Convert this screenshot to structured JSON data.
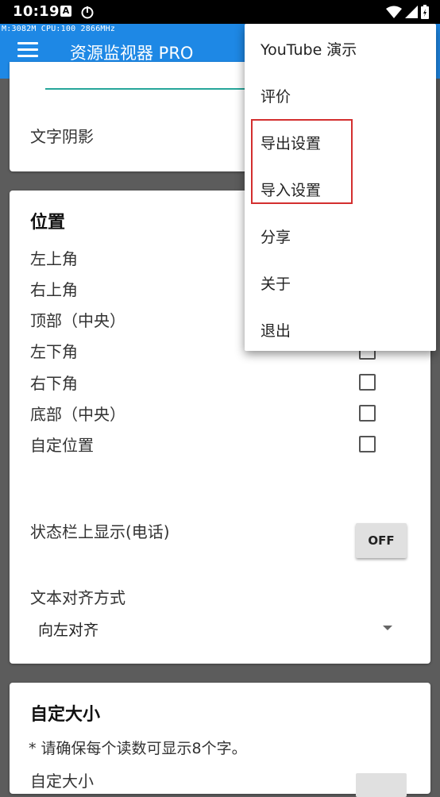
{
  "status_bar": {
    "time": "10:19",
    "notification_badge": "A"
  },
  "app_bar": {
    "overlay_stats": "M:3082M CPU:100 2866MHz",
    "title": "资源监视器 PRO"
  },
  "card_top": {
    "text_shadow_label": "文字阴影"
  },
  "position_section": {
    "title": "位置",
    "options": [
      "左上角",
      "右上角",
      "顶部（中央）",
      "左下角",
      "右下角",
      "底部（中央）",
      "自定位置"
    ],
    "statusbar_label": "状态栏上显示(电话)",
    "statusbar_toggle": "OFF",
    "alignment_label": "文本对齐方式",
    "alignment_value": "向左对齐"
  },
  "custom_size_section": {
    "title": "自定大小",
    "note": "* 请确保每个读数可显示8个字。",
    "row_label": "自定大小"
  },
  "menu": {
    "items": [
      "YouTube 演示",
      "评价",
      "导出设置",
      "导入设置",
      "分享",
      "关于",
      "退出"
    ]
  },
  "colors": {
    "app_bar": "#1e88e5",
    "accent_line": "#26a69a",
    "highlight_border": "#d32f2f"
  }
}
